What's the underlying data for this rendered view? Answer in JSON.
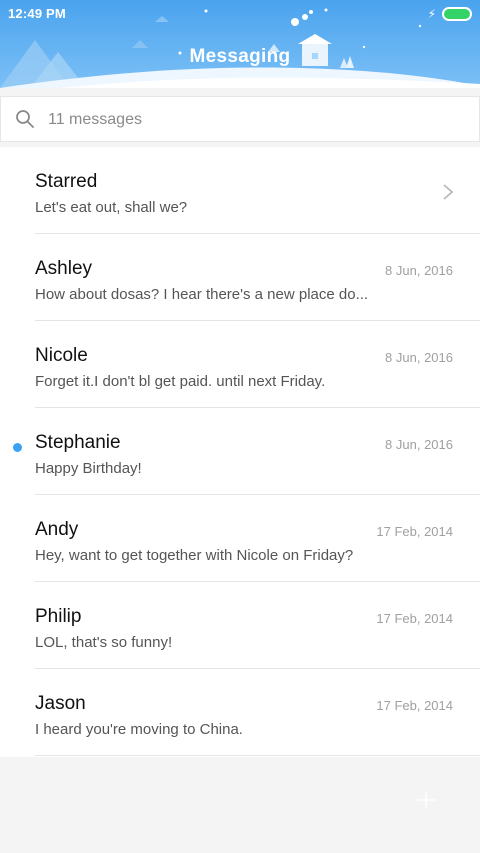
{
  "status_bar": {
    "time": "12:49 PM",
    "battery_color": "#33d36a"
  },
  "header": {
    "title": "Messaging",
    "gradient_top": "#4aa3ee",
    "gradient_bottom": "#7cc0f6"
  },
  "search": {
    "placeholder": "11 messages",
    "icon": "search-icon"
  },
  "conversations": [
    {
      "name": "Starred",
      "preview": "Let's eat out, shall we?",
      "date": "",
      "unread": false,
      "has_chevron": true
    },
    {
      "name": "Ashley",
      "preview": "How about dosas? I hear there's a new place do...",
      "date": "8 Jun, 2016",
      "unread": false
    },
    {
      "name": "Nicole",
      "preview": "Forget it.I don't bl get paid. until next Friday.",
      "date": "8 Jun, 2016",
      "unread": false
    },
    {
      "name": "Stephanie",
      "preview": "Happy Birthday!",
      "date": "8 Jun, 2016",
      "unread": true
    },
    {
      "name": "Andy",
      "preview": "Hey, want to get together with Nicole on Friday?",
      "date": "17 Feb, 2014",
      "unread": false
    },
    {
      "name": "Philip",
      "preview": "LOL, that's so funny!",
      "date": "17 Feb, 2014",
      "unread": false
    },
    {
      "name": "Jason",
      "preview": "I heard you're moving to China.",
      "date": "17 Feb, 2014",
      "unread": false
    }
  ],
  "accent": "#3aa1f3",
  "compose": {
    "icon": "plus-icon"
  }
}
